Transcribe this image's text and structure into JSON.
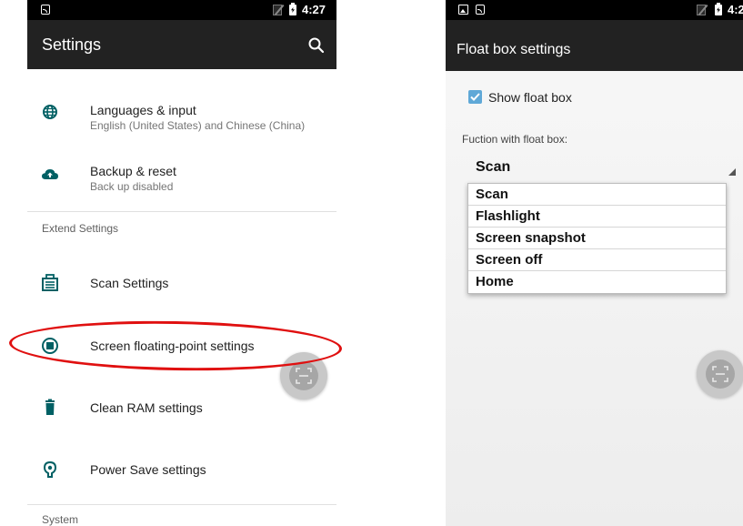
{
  "left_screen": {
    "status_time": "4:27",
    "app_title": "Settings",
    "items": [
      {
        "title": "Languages & input",
        "subtitle": "English (United States) and Chinese (China)"
      },
      {
        "title": "Backup & reset",
        "subtitle": "Back up disabled"
      },
      {
        "title": "Scan Settings"
      },
      {
        "title": "Screen floating-point settings"
      },
      {
        "title": "Clean RAM settings"
      },
      {
        "title": "Power Save settings"
      }
    ],
    "sections": [
      "Extend Settings",
      "System"
    ]
  },
  "right_screen": {
    "status_time": "4:2",
    "title": "Float box settings",
    "checkbox_label": "Show float box",
    "checkbox_checked": true,
    "function_label": "Fuction with float box:",
    "selected": "Scan",
    "options": [
      "Scan",
      "Flashlight",
      "Screen snapshot",
      "Screen off",
      "Home"
    ]
  },
  "colors": {
    "appbar": "#222222",
    "statusbar": "#000000",
    "highlight": "#e01010",
    "checkbox": "#5fa8d7",
    "icon_teal": "#006064",
    "fab": "#c8c8c8"
  }
}
